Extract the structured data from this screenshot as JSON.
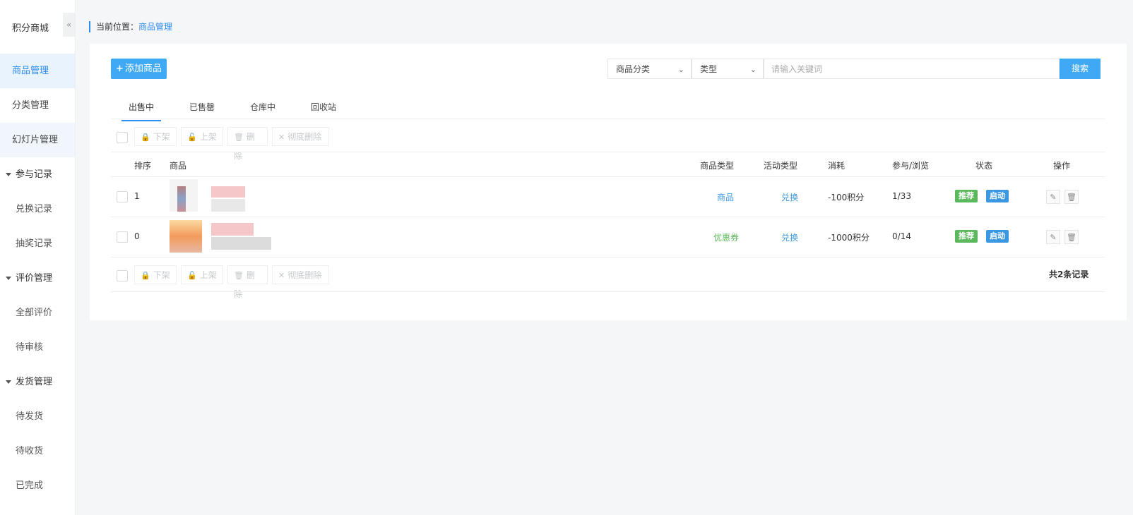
{
  "sidebar": {
    "brand": "积分商城",
    "collapse_icon": "«",
    "items": [
      {
        "label": "商品管理"
      },
      {
        "label": "分类管理"
      },
      {
        "label": "幻灯片管理"
      }
    ],
    "groups": [
      {
        "label": "参与记录",
        "children": [
          "兑换记录",
          "抽奖记录"
        ]
      },
      {
        "label": "评价管理",
        "children": [
          "全部评价",
          "待审核"
        ]
      },
      {
        "label": "发货管理",
        "children": [
          "待发货",
          "待收货",
          "已完成"
        ]
      }
    ]
  },
  "breadcrumb": {
    "prefix": "当前位置：",
    "current": "商品管理"
  },
  "toolbar": {
    "add_label": "添加商品",
    "category_select": "商品分类",
    "type_select": "类型",
    "search_placeholder": "请输入关键词",
    "search_label": "搜索"
  },
  "tabs": [
    "出售中",
    "已售罄",
    "仓库中",
    "回收站"
  ],
  "batch_actions": [
    "下架",
    "上架",
    "删除",
    "彻底删除"
  ],
  "table": {
    "headers": [
      "排序",
      "商品",
      "商品类型",
      "活动类型",
      "消耗",
      "参与/浏览",
      "状态",
      "操作"
    ],
    "rows": [
      {
        "sort": "1",
        "product_type": "商品",
        "activity_type": "兑换",
        "cost": "-100积分",
        "participation": "1/33",
        "tag_recommend": "推荐",
        "tag_enable": "启动"
      },
      {
        "sort": "0",
        "product_type": "优惠券",
        "activity_type": "兑换",
        "cost": "-1000积分",
        "participation": "0/14",
        "tag_recommend": "推荐",
        "tag_enable": "启动"
      }
    ]
  },
  "total_text": "共2条记录",
  "colors": {
    "accent": "#3fa9f5",
    "link": "#3b98e0",
    "green": "#5cb85c"
  }
}
